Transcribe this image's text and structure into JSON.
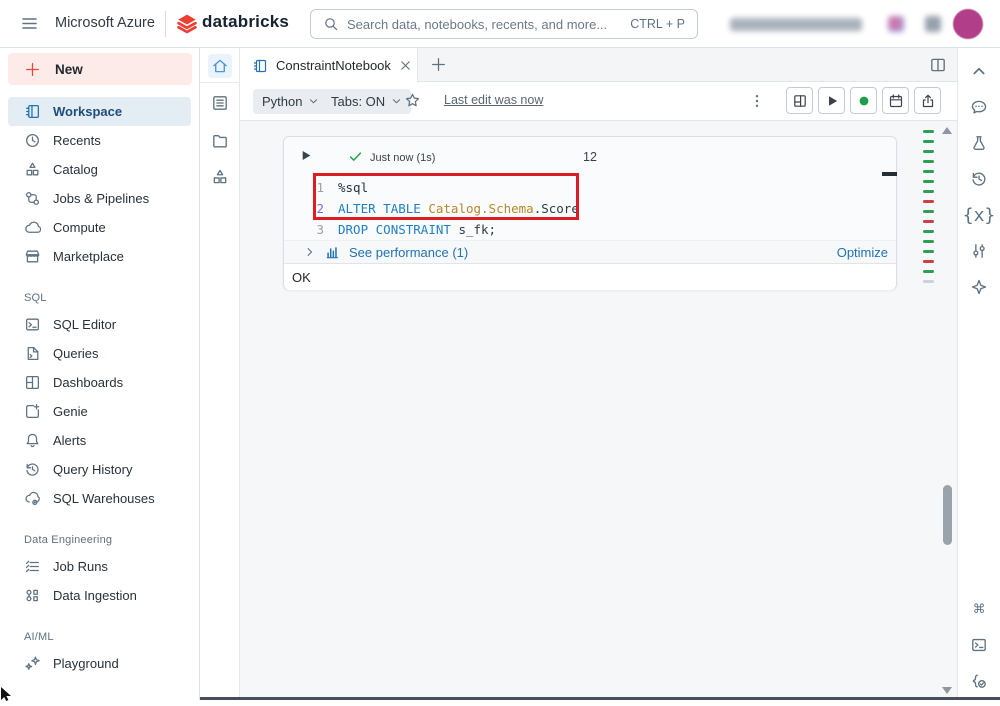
{
  "colors": {
    "accent_blue": "#2272b4",
    "brand_red": "#ee3d33",
    "success_green": "#24a147",
    "annotation_red": "#dd1d26",
    "minimap_green": "#2e9e54",
    "minimap_red": "#ce3e47",
    "minimap_gray": "#ccd2da"
  },
  "topbar": {
    "azure_label": "Microsoft Azure",
    "brand_label": "databricks",
    "search": {
      "placeholder": "Search data, notebooks, recents, and more...",
      "shortcut": "CTRL + P"
    },
    "right": {
      "workspace_name_blurred": true,
      "avatar": true
    }
  },
  "sidebar": {
    "new_label": "New",
    "sections": [
      {
        "label": null,
        "items": [
          {
            "icon": "notebook",
            "label": "Workspace",
            "active": true
          },
          {
            "icon": "clock",
            "label": "Recents"
          },
          {
            "icon": "catalog",
            "label": "Catalog"
          },
          {
            "icon": "flow",
            "label": "Jobs & Pipelines"
          },
          {
            "icon": "cloud",
            "label": "Compute"
          },
          {
            "icon": "store",
            "label": "Marketplace"
          }
        ]
      },
      {
        "label": "SQL",
        "items": [
          {
            "icon": "terminalbox",
            "label": "SQL Editor"
          },
          {
            "icon": "querydoc",
            "label": "Queries"
          },
          {
            "icon": "grid",
            "label": "Dashboards"
          },
          {
            "icon": "genie",
            "label": "Genie"
          },
          {
            "icon": "bell",
            "label": "Alerts"
          },
          {
            "icon": "historyclock",
            "label": "Query History"
          },
          {
            "icon": "cloudgear",
            "label": "SQL Warehouses"
          }
        ]
      },
      {
        "label": "Data Engineering",
        "items": [
          {
            "icon": "checklist",
            "label": "Job Runs"
          },
          {
            "icon": "ingestion",
            "label": "Data Ingestion"
          }
        ]
      },
      {
        "label": "AI/ML",
        "items": [
          {
            "icon": "sparkles",
            "label": "Playground"
          }
        ]
      }
    ]
  },
  "notebook": {
    "tab_title": "ConstraintNotebook",
    "toolbar": {
      "language": "Python",
      "tabs_setting": "Tabs: ON",
      "last_edit": "Last edit was now",
      "actions": [
        {
          "id": "layout",
          "icon": "layout"
        },
        {
          "id": "run-all",
          "icon": "play"
        },
        {
          "id": "cluster-status",
          "icon": "greendot"
        },
        {
          "id": "schedule",
          "icon": "calendar"
        },
        {
          "id": "share",
          "icon": "share"
        }
      ]
    }
  },
  "cell": {
    "status_text": "Just now (1s)",
    "exec_count": "12",
    "code_lines": [
      {
        "num": "1",
        "num_class": "",
        "tokens": [
          [
            "plain",
            "%sql"
          ]
        ]
      },
      {
        "num": "2",
        "num_class": "active",
        "tokens": [
          [
            "kw",
            "ALTER"
          ],
          [
            "plain",
            " "
          ],
          [
            "kw",
            "TABLE"
          ],
          [
            "plain",
            " "
          ],
          [
            "gold",
            "Catalog.Schema"
          ],
          [
            "dark",
            ".Score"
          ]
        ]
      },
      {
        "num": "3",
        "num_class": "",
        "tokens": [
          [
            "kw",
            "DROP"
          ],
          [
            "plain",
            " "
          ],
          [
            "kw",
            "CONSTRAINT"
          ],
          [
            "plain",
            " "
          ],
          [
            "dark",
            "s_fk;"
          ]
        ]
      }
    ],
    "performance_label": "See performance (1)",
    "optimize_label": "Optimize",
    "output_text": "OK"
  },
  "minimap": {
    "marks": [
      "green",
      "green",
      "green",
      "green",
      "green",
      "green",
      "green",
      "red",
      "green",
      "red",
      "green",
      "green",
      "green",
      "red",
      "green",
      "gray"
    ]
  },
  "right_rail": {
    "top_icons": [
      {
        "id": "collapse-panel",
        "icon": "chevup"
      },
      {
        "id": "comments",
        "icon": "comment"
      },
      {
        "id": "experiments",
        "icon": "flask"
      },
      {
        "id": "version-history",
        "icon": "historyclock"
      },
      {
        "id": "variables",
        "icon": "varsx"
      },
      {
        "id": "environment",
        "icon": "sliders"
      },
      {
        "id": "assistant",
        "icon": "diamond4"
      }
    ],
    "bottom_icons": [
      {
        "id": "shortcuts",
        "icon": "command"
      },
      {
        "id": "terminal",
        "icon": "terminal2"
      },
      {
        "id": "code-validate",
        "icon": "codecheck"
      }
    ]
  }
}
